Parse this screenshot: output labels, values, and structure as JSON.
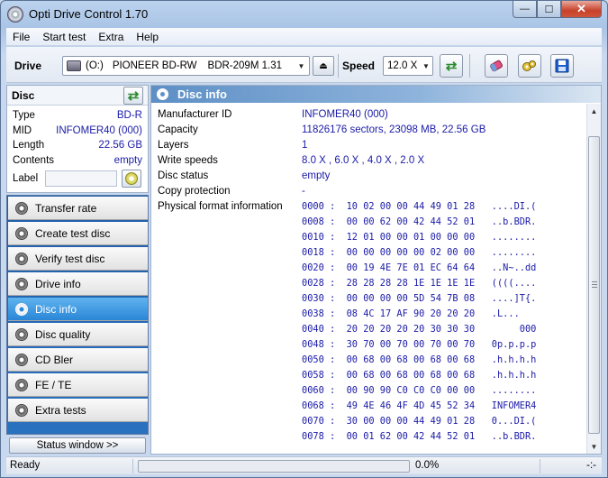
{
  "window": {
    "title": "Opti Drive Control 1.70",
    "controls": {
      "minimize": "—",
      "maximize": "☐",
      "close": "✕"
    }
  },
  "menu": [
    "File",
    "Start test",
    "Extra",
    "Help"
  ],
  "toolbar": {
    "drive_label": "Drive",
    "drive_letter": "(O:)",
    "drive_name": "PIONEER BD-RW",
    "drive_model": "BDR-209M 1.31",
    "speed_label": "Speed",
    "speed_value": "12.0 X",
    "icons": [
      "eject-icon",
      "refresh-icon",
      "erase-icon",
      "config-icon",
      "save-icon"
    ],
    "accent_colors": {
      "refresh": "#2d8a2d",
      "save": "#1e5fd0",
      "erase": "#e05080"
    }
  },
  "disc": {
    "header": "Disc",
    "fields": [
      {
        "key": "Type",
        "value": "BD-R"
      },
      {
        "key": "MID",
        "value": "INFOMER40 (000)"
      },
      {
        "key": "Length",
        "value": "22.56 GB"
      },
      {
        "key": "Contents",
        "value": "empty"
      }
    ],
    "label_key": "Label",
    "label_value": ""
  },
  "nav": {
    "items": [
      "Transfer rate",
      "Create test disc",
      "Verify test disc",
      "Drive info",
      "Disc info",
      "Disc quality",
      "CD Bler",
      "FE / TE",
      "Extra tests"
    ],
    "active": "Disc info",
    "status_window_button": "Status window >>"
  },
  "info": {
    "header": "Disc info",
    "rows": [
      {
        "key": "Manufacturer ID",
        "value": "INFOMER40 (000)"
      },
      {
        "key": "Capacity",
        "value": "11826176 sectors, 23098 MB, 22.56 GB"
      },
      {
        "key": "Layers",
        "value": "1"
      },
      {
        "key": "Write speeds",
        "value": "8.0 X , 6.0 X , 4.0 X , 2.0 X"
      },
      {
        "key": "Disc status",
        "value": "empty"
      },
      {
        "key": "Copy protection",
        "value": "-"
      },
      {
        "key": "Physical format information",
        "value": ""
      }
    ],
    "hex_dump": [
      "0000 :  10 02 00 00 44 49 01 28   ....DI.(",
      "0008 :  00 00 62 00 42 44 52 01   ..b.BDR.",
      "0010 :  12 01 00 00 01 00 00 00   ........",
      "0018 :  00 00 00 00 00 02 00 00   ........",
      "0020 :  00 19 4E 7E 01 EC 64 64   ..N~..dd",
      "0028 :  28 28 28 28 1E 1E 1E 1E   ((((....",
      "0030 :  00 00 00 00 5D 54 7B 08   ....]T{.",
      "0038 :  08 4C 17 AF 90 20 20 20   .L...   ",
      "0040 :  20 20 20 20 20 30 30 30        000",
      "0048 :  30 70 00 70 00 70 00 70   0p.p.p.p",
      "0050 :  00 68 00 68 00 68 00 68   .h.h.h.h",
      "0058 :  00 68 00 68 00 68 00 68   .h.h.h.h",
      "0060 :  00 90 90 C0 C0 C0 00 00   ........",
      "0068 :  49 4E 46 4F 4D 45 52 34   INFOMER4",
      "0070 :  30 00 00 00 44 49 01 28   0...DI.(",
      "0078 :  00 01 62 00 42 44 52 01   ..b.BDR."
    ]
  },
  "statusbar": {
    "status": "Ready",
    "progress_percent": 0,
    "percent_label": "0.0%",
    "time": "-:-",
    "progress_color": "#3bb33b"
  }
}
